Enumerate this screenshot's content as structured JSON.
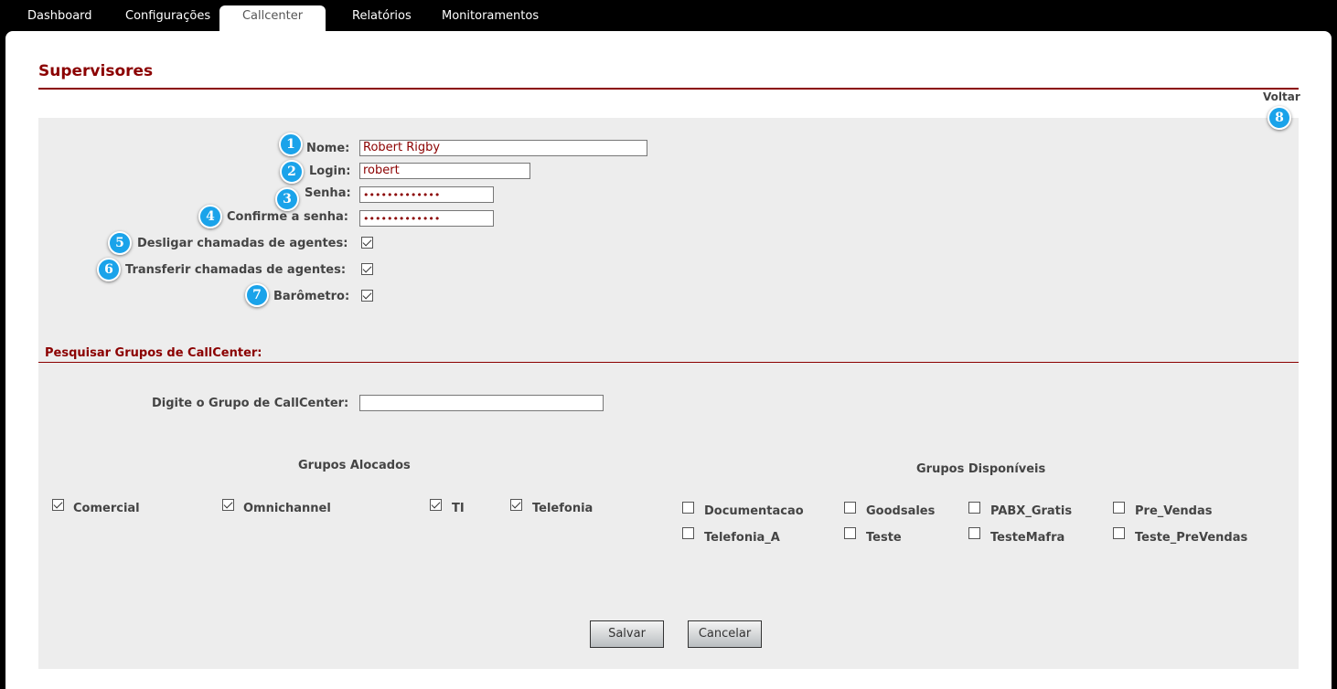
{
  "nav": {
    "tabs": [
      "Dashboard",
      "Configurações",
      "Callcenter",
      "Relatórios",
      "Monitoramentos"
    ],
    "active": "Callcenter"
  },
  "page": {
    "title": "Supervisores",
    "back_link": "Voltar"
  },
  "form": {
    "name_label": "Nome:",
    "name_value": "Robert Rigby",
    "login_label": "Login:",
    "login_value": "robert",
    "password_label": "Senha:",
    "password_value": "•••••••••••••",
    "confirm_label": "Confirme a senha:",
    "confirm_value": "•••••••••••••",
    "hangup_label": "Desligar chamadas de agentes:",
    "hangup_checked": true,
    "transfer_label": "Transferir chamadas de agentes:",
    "transfer_checked": true,
    "barometer_label": "Barômetro:",
    "barometer_checked": true
  },
  "search": {
    "section_title": "Pesquisar Grupos de CallCenter:",
    "label": "Digite o Grupo de CallCenter:",
    "value": ""
  },
  "allocated": {
    "title": "Grupos Alocados",
    "items": [
      "Comercial",
      "Omnichannel",
      "TI",
      "Telefonia"
    ]
  },
  "available": {
    "title": "Grupos Disponíveis",
    "items": [
      "Documentacao",
      "Goodsales",
      "PABX_Gratis",
      "Pre_Vendas",
      "Telefonia_A",
      "Teste",
      "TesteMafra",
      "Teste_PreVendas"
    ]
  },
  "actions": {
    "save": "Salvar",
    "cancel": "Cancelar"
  },
  "badges": [
    "1",
    "2",
    "3",
    "4",
    "5",
    "6",
    "7",
    "8"
  ],
  "colors": {
    "accent": "#8b0000",
    "badge": "#1aa3ea",
    "panel": "#ededed"
  }
}
